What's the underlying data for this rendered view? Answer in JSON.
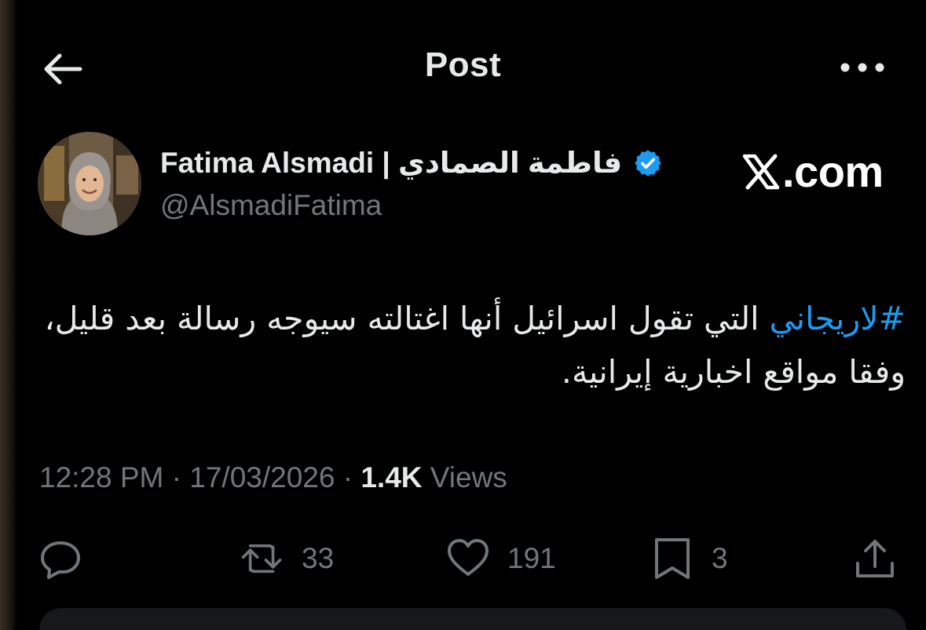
{
  "header": {
    "title": "Post"
  },
  "author": {
    "display_name": "Fatima Alsmadi | فاطمة الصمادي",
    "handle": "@AlsmadiFatima",
    "verified": true
  },
  "watermark": {
    "domain_suffix": ".com"
  },
  "post": {
    "hashtag": "#لاريجاني",
    "text": " التي تقول اسرائيل أنها اغتالته سيوجه رسالة بعد قليل، وفقا مواقع اخبارية إيرانية."
  },
  "meta": {
    "time": "12:28 PM",
    "date": "17/03/2026",
    "separator": "·",
    "views_count": "1.4K",
    "views_label": "Views"
  },
  "actions": {
    "reposts": "33",
    "likes": "191",
    "bookmarks": "3"
  },
  "colors": {
    "background": "#000000",
    "text_primary": "#e7e9ea",
    "text_secondary": "#71767b",
    "accent": "#1d9bf0"
  },
  "icons": {
    "back": "arrow-left-icon",
    "more": "ellipsis-icon",
    "verified": "verified-badge-icon",
    "reply": "reply-icon",
    "repost": "repost-icon",
    "like": "heart-icon",
    "bookmark": "bookmark-icon",
    "share": "share-icon"
  }
}
